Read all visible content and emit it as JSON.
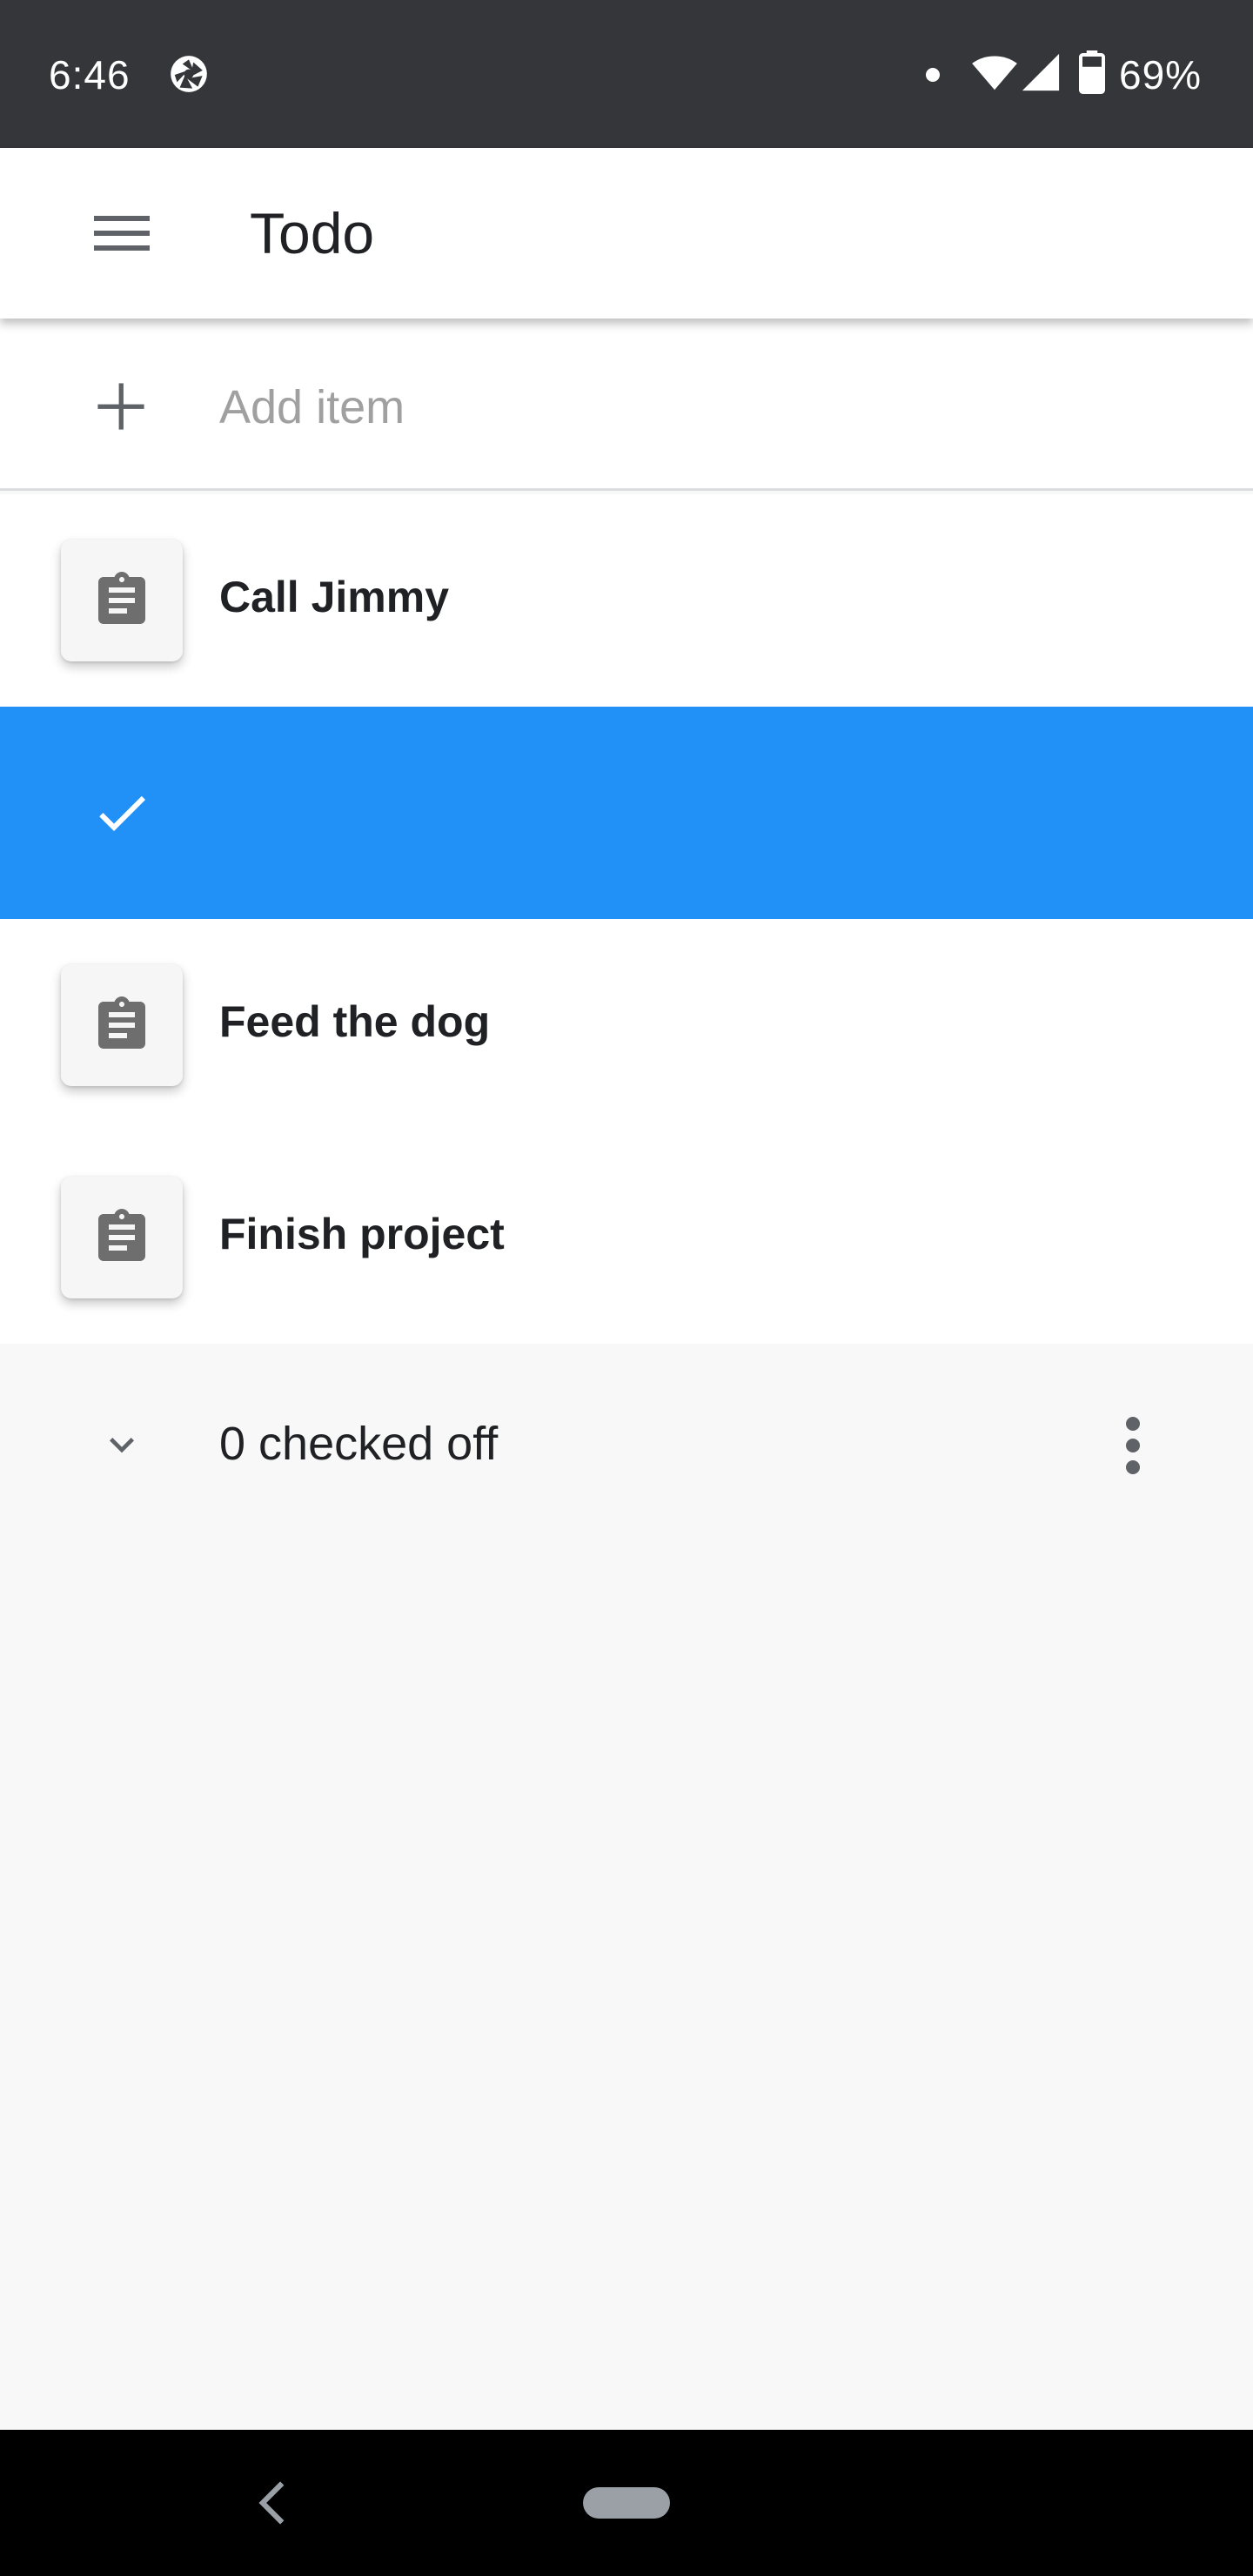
{
  "status_bar": {
    "time": "6:46",
    "battery": "69%",
    "icons": [
      "camera-shutter-icon",
      "notification-dot-icon",
      "wifi-icon",
      "cell-signal-icon",
      "battery-icon"
    ]
  },
  "app_bar": {
    "title": "Todo",
    "menu_icon": "hamburger-menu-icon"
  },
  "add_item": {
    "placeholder": "Add item",
    "value": "",
    "icon": "plus-icon"
  },
  "todos": [
    {
      "label": "Call Jimmy",
      "icon": "clipboard-icon"
    },
    {
      "label": "",
      "icon": "check-icon",
      "selected": true
    },
    {
      "label": "Feed the dog",
      "icon": "clipboard-icon"
    },
    {
      "label": "Finish project",
      "icon": "clipboard-icon"
    }
  ],
  "checked_section": {
    "label": "0 checked off",
    "icon": "chevron-down-icon",
    "more_icon": "more-vert-icon"
  },
  "colors": {
    "status_bar": "#35363a",
    "selected_row": "#2190f7",
    "background": "#f8f8f8",
    "icon_gray": "#5f6368"
  },
  "nav_bar": {
    "icons": [
      "back-icon",
      "home-pill-icon"
    ]
  }
}
